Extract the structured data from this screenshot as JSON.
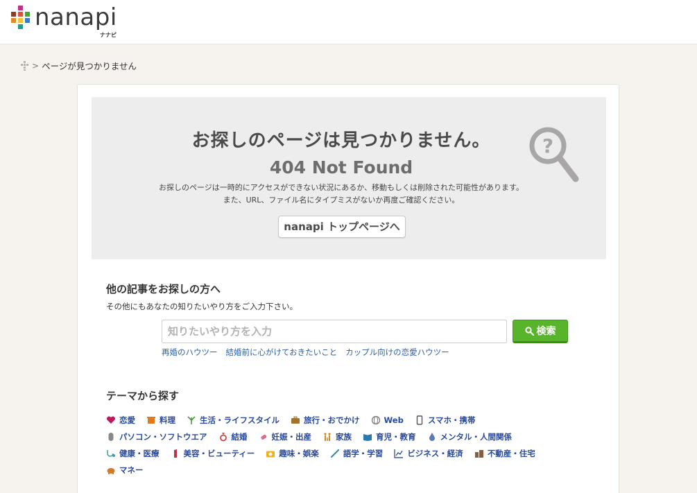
{
  "header": {
    "logo_text": "nanapi",
    "logo_sub": "ナナピ",
    "logo_colors": [
      "#8a3b2a",
      "#d9533c",
      "#4aa23c",
      "#e08b2a",
      "#3a79c4",
      "#b8338a",
      "#f1c232",
      "#2a9a8a"
    ]
  },
  "breadcrumb": {
    "current": "ページが見つかりません"
  },
  "notfound": {
    "title": "お探しのページは見つかりません。",
    "code": "404 Not Found",
    "desc_line1": "お探しのページは一時的にアクセスができない状況にあるか、移動もしくは削除された可能性があります。",
    "desc_line2": "また、URL、ファイル名にタイプミスがないか再度ご確認ください。",
    "top_button": "nanapi トップページへ"
  },
  "search": {
    "heading": "他の記事をお探しの方へ",
    "help": "その他にもあなたの知りたいやり方をご入力下さい。",
    "placeholder": "知りたいやり方を入力",
    "button": "検索",
    "suggestions": [
      "再婚のハウツー",
      "結婚前に心がけておきたいこと",
      "カップル向けの恋愛ハウツー"
    ]
  },
  "themes": {
    "heading": "テーマから探す",
    "rows": [
      [
        {
          "label": "恋愛",
          "icon": "heart-icon",
          "color": "#c2185b"
        },
        {
          "label": "料理",
          "icon": "pot-icon",
          "color": "#e07a1a"
        },
        {
          "label": "生活・ライフスタイル",
          "icon": "plant-icon",
          "color": "#4a9a3a"
        },
        {
          "label": "旅行・おでかけ",
          "icon": "bag-icon",
          "color": "#a5742a"
        },
        {
          "label": "Web",
          "icon": "globe-icon",
          "color": "#7a7a7a"
        },
        {
          "label": "スマホ・携帯",
          "icon": "phone-icon",
          "color": "#555555"
        }
      ],
      [
        {
          "label": "パソコン・ソフトウエア",
          "icon": "mouse-icon",
          "color": "#888888"
        },
        {
          "label": "結婚",
          "icon": "ring-icon",
          "color": "#c44"
        },
        {
          "label": "妊娠・出産",
          "icon": "bottle-icon",
          "color": "#e06a8a"
        },
        {
          "label": "家族",
          "icon": "family-icon",
          "color": "#d08a2a"
        },
        {
          "label": "育児・教育",
          "icon": "book-icon",
          "color": "#2a7ab0"
        },
        {
          "label": "メンタル・人間関係",
          "icon": "drop-icon",
          "color": "#5a7ab8"
        }
      ],
      [
        {
          "label": "健康・医療",
          "icon": "stethoscope-icon",
          "color": "#3aa0a0"
        },
        {
          "label": "美容・ビューティー",
          "icon": "lipstick-icon",
          "color": "#c0304a"
        },
        {
          "label": "趣味・娯楽",
          "icon": "camera-icon",
          "color": "#f0b020"
        },
        {
          "label": "語学・学習",
          "icon": "pen-icon",
          "color": "#3a8ab0"
        },
        {
          "label": "ビジネス・経済",
          "icon": "graph-icon",
          "color": "#3a5a9a"
        },
        {
          "label": "不動産・住宅",
          "icon": "building-icon",
          "color": "#8a5a3a"
        }
      ],
      [
        {
          "label": "マネー",
          "icon": "piggybank-icon",
          "color": "#d07a2a"
        }
      ]
    ]
  }
}
